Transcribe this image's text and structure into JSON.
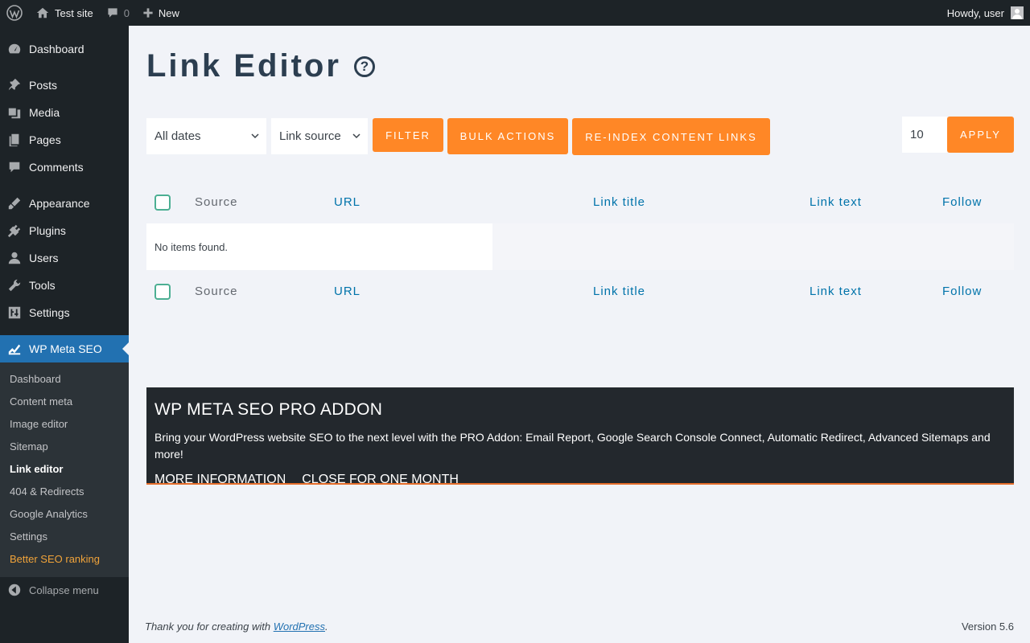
{
  "adminbar": {
    "site_name": "Test site",
    "comments_count": "0",
    "new_label": "New",
    "greeting": "Howdy, user"
  },
  "sidebar": {
    "items": [
      {
        "label": "Dashboard",
        "icon": "dashboard-icon"
      },
      {
        "label": "Posts",
        "icon": "pin-icon"
      },
      {
        "label": "Media",
        "icon": "media-icon"
      },
      {
        "label": "Pages",
        "icon": "pages-icon"
      },
      {
        "label": "Comments",
        "icon": "comment-icon"
      },
      {
        "label": "Appearance",
        "icon": "brush-icon"
      },
      {
        "label": "Plugins",
        "icon": "plug-icon"
      },
      {
        "label": "Users",
        "icon": "user-icon"
      },
      {
        "label": "Tools",
        "icon": "wrench-icon"
      },
      {
        "label": "Settings",
        "icon": "settings-icon"
      },
      {
        "label": "WP Meta SEO",
        "icon": "chart-icon"
      }
    ],
    "submenu": [
      "Dashboard",
      "Content meta",
      "Image editor",
      "Sitemap",
      "Link editor",
      "404 & Redirects",
      "Google Analytics",
      "Settings",
      "Better SEO ranking"
    ],
    "collapse_label": "Collapse menu"
  },
  "main": {
    "title": "Link Editor",
    "help_glyph": "?",
    "filters": {
      "dates": "All dates",
      "source": "Link source",
      "filter_button": "FILTER",
      "bulk_button": "BULK ACTIONS",
      "reindex_button": "RE-INDEX CONTENT LINKS",
      "per_page": "10",
      "apply_button": "APPLY"
    },
    "table": {
      "columns": [
        "Source",
        "URL",
        "Link title",
        "Link text",
        "Follow"
      ],
      "empty_message": "No items found."
    },
    "promo": {
      "title": "WP META SEO PRO ADDON",
      "text": "Bring your WordPress website SEO to the next level with the PRO Addon: Email Report, Google Search Console Connect, Automatic Redirect, Advanced Sitemaps and more!",
      "more_info": "MORE INFORMATION",
      "close": "CLOSE FOR ONE MONTH"
    }
  },
  "footer": {
    "thanks_prefix": "Thank you for creating with ",
    "wp_link": "WordPress",
    "thanks_suffix": ".",
    "version": "Version 5.6"
  },
  "colors": {
    "accent_orange": "#ff8726",
    "wp_blue": "#2271b1",
    "admin_dark": "#1d2327"
  }
}
